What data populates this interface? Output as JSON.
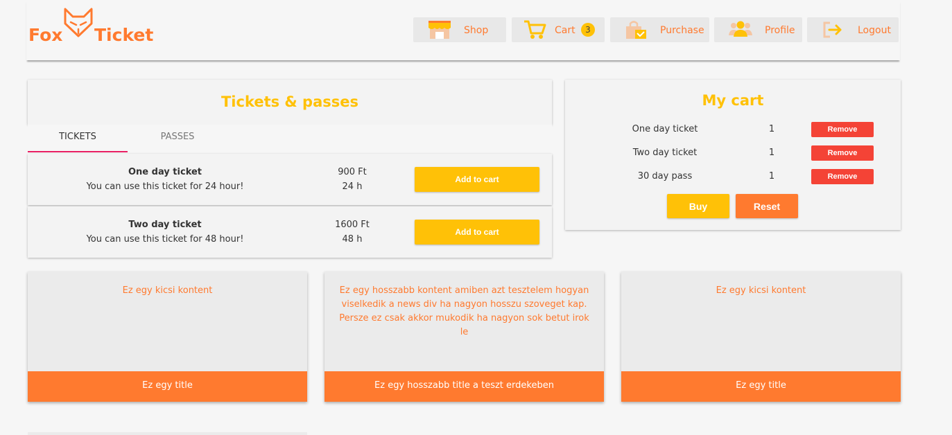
{
  "app": {
    "logo_left": "Fox",
    "logo_right": "Ticket",
    "accent_color": "#ff7a2f",
    "highlight_color": "#ffc107"
  },
  "nav": {
    "shop": {
      "label": "Shop",
      "icon": "shop-icon"
    },
    "cart": {
      "label": "Cart",
      "icon": "cart-icon",
      "badge": "3"
    },
    "purchase": {
      "label": "Purchase",
      "icon": "purchase-icon"
    },
    "profile": {
      "label": "Profile",
      "icon": "users-icon"
    },
    "logout": {
      "label": "Logout",
      "icon": "logout-icon"
    }
  },
  "tickets_panel": {
    "title": "Tickets & passes",
    "tabs": [
      {
        "label": "TICKETS",
        "active": true
      },
      {
        "label": "PASSES",
        "active": false
      }
    ],
    "items": [
      {
        "name": "One day ticket",
        "description": "You can use this ticket for 24 hour!",
        "price": "900 Ft",
        "duration": "24 h",
        "button": "Add to cart"
      },
      {
        "name": "Two day ticket",
        "description": "You can use this ticket for 48 hour!",
        "price": "1600 Ft",
        "duration": "48 h",
        "button": "Add to cart"
      }
    ]
  },
  "cart_panel": {
    "title": "My cart",
    "items": [
      {
        "name": "One day ticket",
        "qty": "1",
        "button": "Remove"
      },
      {
        "name": "Two day ticket",
        "qty": "1",
        "button": "Remove"
      },
      {
        "name": "30 day pass",
        "qty": "1",
        "button": "Remove"
      }
    ],
    "buy_label": "Buy",
    "reset_label": "Reset"
  },
  "news": [
    {
      "content": "Ez egy kicsi kontent",
      "title": "Ez egy title"
    },
    {
      "content": "Ez egy hosszabb kontent amiben azt tesztelem hogyan viselkedik a news div ha nagyon hosszu szoveget kap. Persze ez csak akkor mukodik ha nagyon sok betut irok le",
      "title": "Ez egy hosszabb title a teszt erdekeben"
    },
    {
      "content": "Ez egy kicsi kontent",
      "title": "Ez egy title"
    }
  ]
}
